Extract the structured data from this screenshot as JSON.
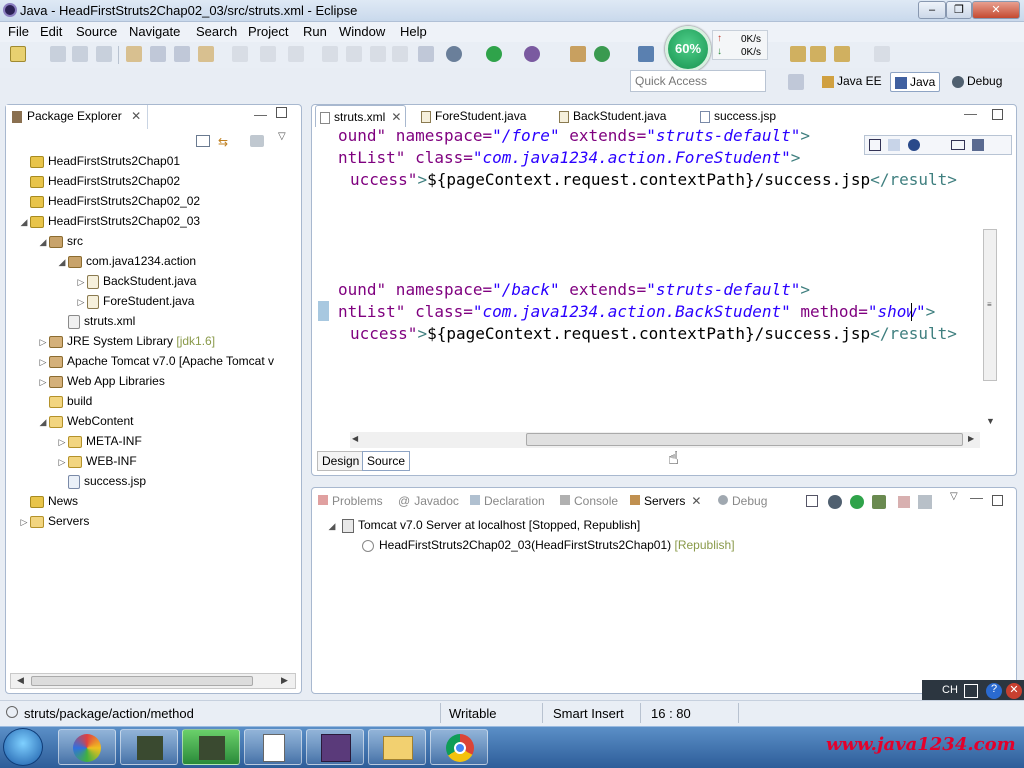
{
  "window": {
    "title": "Java - HeadFirstStruts2Chap02_03/src/struts.xml - Eclipse"
  },
  "menu": [
    "File",
    "Edit",
    "Source",
    "Navigate",
    "Search",
    "Project",
    "Run",
    "Window",
    "Help"
  ],
  "speed": {
    "percent": "60%",
    "up": "0K/s",
    "down": "0K/s"
  },
  "quick_access": {
    "placeholder": "Quick Access"
  },
  "perspectives": [
    "Java EE",
    "Java",
    "Debug"
  ],
  "package_explorer": {
    "title": "Package Explorer",
    "items": [
      {
        "label": "HeadFirstStruts2Chap01"
      },
      {
        "label": "HeadFirstStruts2Chap02"
      },
      {
        "label": "HeadFirstStruts2Chap02_02"
      },
      {
        "label": "HeadFirstStruts2Chap02_03"
      },
      {
        "label": "src"
      },
      {
        "label": "com.java1234.action"
      },
      {
        "label": "BackStudent.java"
      },
      {
        "label": "ForeStudent.java"
      },
      {
        "label": "struts.xml"
      },
      {
        "label": "JRE System Library",
        "suffix": "[jdk1.6]"
      },
      {
        "label": "Apache Tomcat v7.0 [Apache Tomcat v"
      },
      {
        "label": "Web App Libraries"
      },
      {
        "label": "build"
      },
      {
        "label": "WebContent"
      },
      {
        "label": "META-INF"
      },
      {
        "label": "WEB-INF"
      },
      {
        "label": "success.jsp"
      },
      {
        "label": "News"
      },
      {
        "label": "Servers"
      }
    ]
  },
  "editor": {
    "tabs": [
      "struts.xml",
      "ForeStudent.java",
      "BackStudent.java",
      "success.jsp"
    ],
    "bottom_tabs": [
      "Design",
      "Source"
    ],
    "lines": [
      {
        "a": "ound\"",
        "b": " namespace=",
        "c": "\"/fore\"",
        "d": " extends=",
        "e": "\"struts-default\"",
        "f": ">"
      },
      {
        "a": "ntList\"",
        "b": " class=",
        "c": "\"com.java1234.action.ForeStudent\"",
        "d": "",
        "e": "",
        "f": ">"
      },
      {
        "a": "uccess\"",
        "b": ">",
        "c": "${pageContext.request.contextPath}/success.jsp",
        "d": "</result>",
        "e": "",
        "f": ""
      },
      {
        "a": "ound\"",
        "b": " namespace=",
        "c": "\"/back\"",
        "d": " extends=",
        "e": "\"struts-default\"",
        "f": ">"
      },
      {
        "a": "ntList\"",
        "b": " class=",
        "c": "\"com.java1234.action.BackStudent\"",
        "d": " method=",
        "e": "\"show\"",
        "f": ">"
      },
      {
        "a": "uccess\"",
        "b": ">",
        "c": "${pageContext.request.contextPath}/success.jsp",
        "d": "</result>",
        "e": "",
        "f": ""
      }
    ]
  },
  "bottom_panel": {
    "tabs": [
      "Problems",
      "Javadoc",
      "Declaration",
      "Console",
      "Servers",
      "Debug"
    ],
    "server": "Tomcat v7.0 Server at localhost",
    "server_state": "[Stopped, Republish]",
    "module": "HeadFirstStruts2Chap02_03(HeadFirstStruts2Chap01)",
    "module_state": "[Republish]"
  },
  "status": {
    "path": "struts/package/action/method",
    "mode": "Writable",
    "insert": "Smart Insert",
    "position": "16 : 80"
  },
  "ime": {
    "lang": "CH"
  },
  "watermark": "www.java1234.com"
}
